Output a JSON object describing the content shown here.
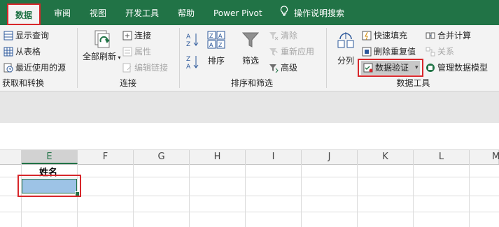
{
  "tabs": [
    {
      "label": "数据",
      "active": true
    },
    {
      "label": "审阅"
    },
    {
      "label": "视图"
    },
    {
      "label": "开发工具"
    },
    {
      "label": "帮助"
    },
    {
      "label": "Power Pivot"
    }
  ],
  "tell_me": {
    "label": "操作说明搜索",
    "icon": "lightbulb-icon"
  },
  "groups": {
    "get_transform": {
      "label": "获取和转换",
      "items": [
        "显示查询",
        "从表格",
        "最近使用的源"
      ]
    },
    "connections": {
      "label": "连接",
      "refresh_all": "全部刷新",
      "items": [
        "连接",
        "属性",
        "编辑链接"
      ]
    },
    "sort_filter": {
      "label": "排序和筛选",
      "sort": "排序",
      "filter": "筛选",
      "items": [
        "清除",
        "重新应用",
        "高级"
      ]
    },
    "data_tools": {
      "label": "数据工具",
      "split": "分列",
      "items": [
        "快速填充",
        "删除重复值",
        "数据验证",
        "合并计算",
        "关系",
        "管理数据模型"
      ]
    }
  },
  "grid": {
    "columns": [
      "E",
      "F",
      "G",
      "H",
      "I",
      "J",
      "K",
      "L",
      "M"
    ],
    "selected_column": "E",
    "header_cell": "姓名"
  },
  "colors": {
    "accent": "#217346",
    "highlight": "#d7262a",
    "selection_fill": "#9dc3e6"
  }
}
